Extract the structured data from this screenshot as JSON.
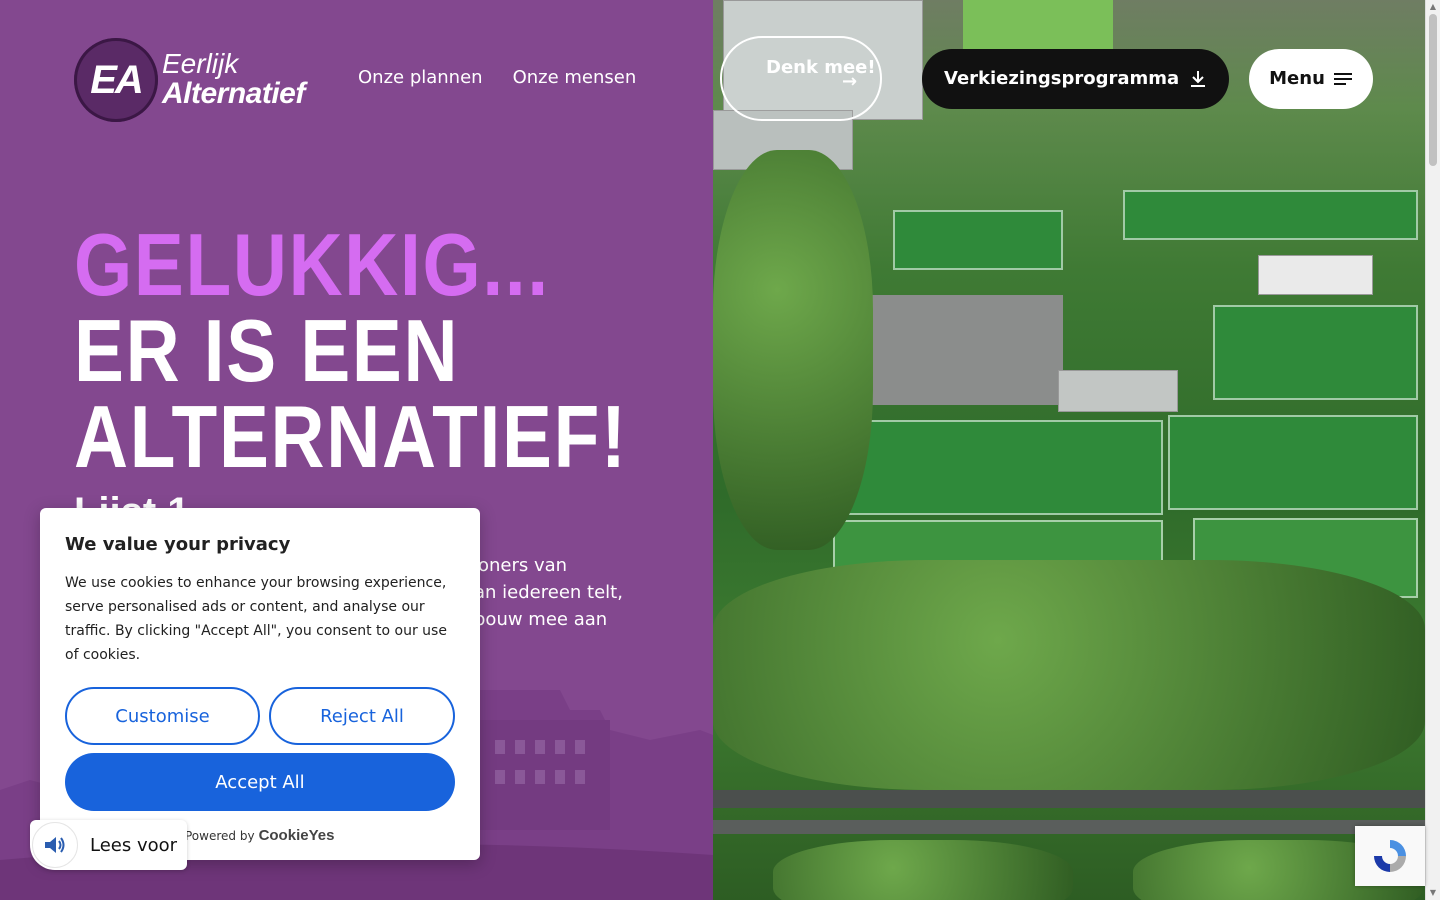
{
  "brand": {
    "badge": "EA",
    "line1": "Eerlijk",
    "line2": "Alternatief"
  },
  "nav": {
    "items": [
      "Onze plannen",
      "Onze mensen"
    ]
  },
  "header": {
    "denk_mee": "Denk mee!",
    "program_label": "Verkiezingsprogramma",
    "menu_label": "Menu"
  },
  "hero": {
    "line1": "GELUKKIG...",
    "line2": "ER IS EEN",
    "line3": "ALTERNATIEF!",
    "sub": "Lijst 1",
    "intro_visible_1": "oners van",
    "intro_visible_2": "an iedereen telt,",
    "intro_visible_3": "bouw mee aan",
    "intro_visible_4": "."
  },
  "cookie": {
    "title": "We value your privacy",
    "body": "We use cookies to enhance your browsing experience, serve personalised ads or content, and analyse our traffic. By clicking \"Accept All\", you consent to our use of cookies.",
    "customise": "Customise",
    "reject": "Reject All",
    "accept": "Accept All",
    "powered_prefix": "Powered by",
    "powered_brand": "CookieYes"
  },
  "read_aloud": {
    "label": "Lees voor"
  },
  "colors": {
    "purple": "#83488f",
    "accent_pink": "#d56cf1",
    "cookie_blue": "#1863dc"
  },
  "icons": {
    "arrow": "arrow-right-icon",
    "download": "download-icon",
    "menu": "hamburger-icon",
    "speaker": "speaker-icon",
    "recaptcha": "recaptcha-icon"
  }
}
